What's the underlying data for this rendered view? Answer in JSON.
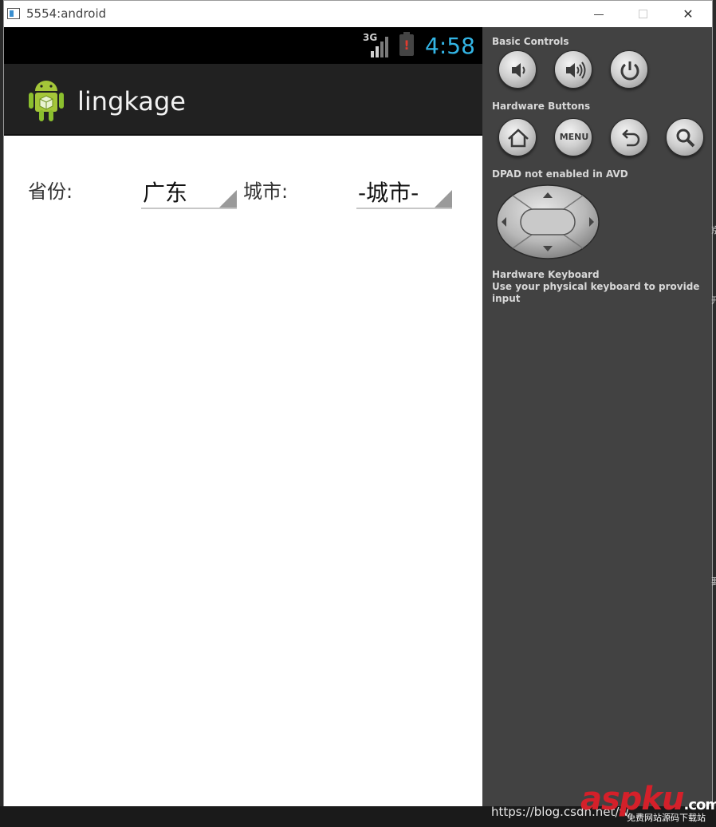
{
  "window": {
    "title": "5554:android",
    "min": "—",
    "close": "✕"
  },
  "status": {
    "network": "3G",
    "battery_alert": "!",
    "time": "4:58"
  },
  "app": {
    "name": "lingkage"
  },
  "form": {
    "province_label": "省份:",
    "province_value": "广东",
    "city_label": "城市:",
    "city_value": "-城市-"
  },
  "panel": {
    "basic_controls": "Basic Controls",
    "hardware_buttons": "Hardware Buttons",
    "menu_label": "MENU",
    "dpad_note": "DPAD not enabled in AVD",
    "keyboard_title": "Hardware Keyboard",
    "keyboard_note": "Use your physical keyboard to provide input"
  },
  "footer": {
    "url": "https://blog.csdn.net/w",
    "watermark": "aspku",
    "watermark_tld": ".com",
    "watermark_sub": "免费网站源码下载站"
  }
}
